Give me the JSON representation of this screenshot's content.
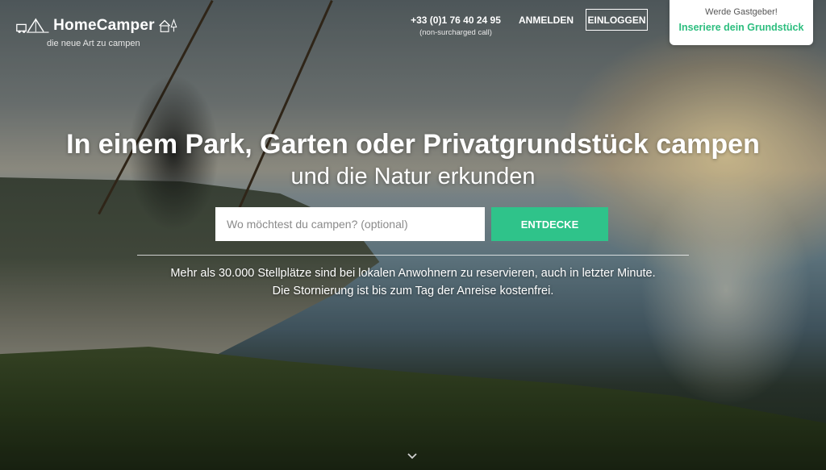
{
  "header": {
    "brand_name": "HomeCamper",
    "brand_tagline": "die neue Art zu campen",
    "phone_number": "+33 (0)1 76 40 24 95",
    "phone_note": "(non-surcharged call)",
    "register_label": "ANMELDEN",
    "login_label": "EINLOGGEN"
  },
  "host_card": {
    "question": "Werde Gastgeber!",
    "link_label": "Inseriere dein Grundstück"
  },
  "hero": {
    "headline": "In einem Park, Garten oder Privatgrundstück campen",
    "subline": "und die Natur erkunden",
    "search_placeholder": "Wo möchtest du campen? (optional)",
    "search_value": "",
    "cta_label": "ENTDECKE",
    "info_line1": "Mehr als 30.000 Stellplätze sind bei lokalen Anwohnern zu reservieren, auch in letzter Minute.",
    "info_line2": "Die Stornierung ist bis zum Tag der Anreise kostenfrei."
  },
  "icons": {
    "logo": "camper-tent-house-icon",
    "scroll": "chevron-down-icon"
  },
  "colors": {
    "accent": "#2fc38a",
    "accent_text": "#2dbe7f"
  }
}
